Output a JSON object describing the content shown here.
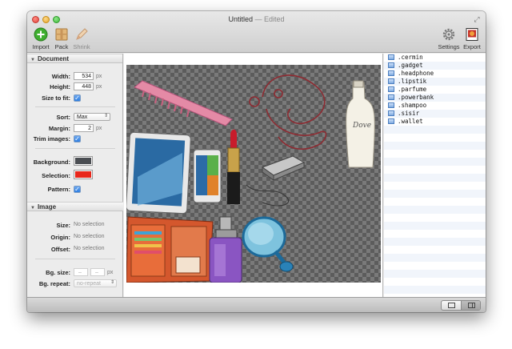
{
  "window": {
    "title": "Untitled",
    "title_suffix": "— Edited"
  },
  "toolbar": {
    "import_label": "Import",
    "pack_label": "Pack",
    "shrink_label": "Shrink",
    "settings_label": "Settings",
    "export_label": "Export"
  },
  "document": {
    "header": "Document",
    "width_label": "Width:",
    "width_value": "534",
    "height_label": "Height:",
    "height_value": "448",
    "unit": "px",
    "size_to_fit_label": "Size to fit:",
    "size_to_fit_checked": true,
    "sort_label": "Sort:",
    "sort_value": "Max",
    "margin_label": "Margin:",
    "margin_value": "2",
    "trim_label": "Trim images:",
    "trim_checked": true,
    "background_label": "Background:",
    "background_color": "#4a4d52",
    "selection_label": "Selection:",
    "selection_color": "#e8261a",
    "pattern_label": "Pattern:",
    "pattern_checked": true
  },
  "image": {
    "header": "Image",
    "size_label": "Size:",
    "origin_label": "Origin:",
    "offset_label": "Offset:",
    "no_selection": "No selection",
    "bgsize_label": "Bg. size:",
    "bgsize_placeholder": "–",
    "bgrepeat_label": "Bg. repeat:",
    "bgrepeat_value": "no-repeat"
  },
  "sprites": [
    ".cermin",
    ".gadget",
    ".headphone",
    ".lipstik",
    ".parfume",
    ".powerbank",
    ".shampoo",
    ".sisir",
    ".wallet"
  ],
  "accent": "#2d7de0"
}
